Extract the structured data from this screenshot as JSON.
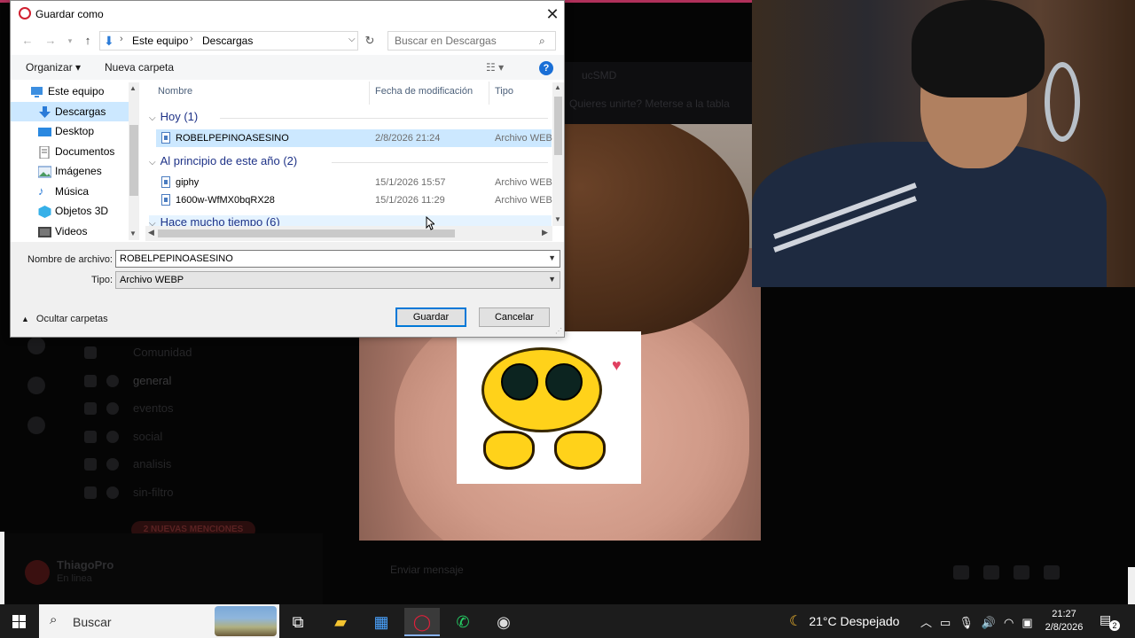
{
  "background_app": {
    "header_line1": "ucSMD",
    "header_line2": "Quieres unirte? Meterse a la tabla",
    "channels": [
      {
        "label": "Comunidad"
      },
      {
        "label": "general"
      },
      {
        "label": "eventos"
      },
      {
        "label": "social"
      },
      {
        "label": "analisis"
      },
      {
        "label": "sin-filtro"
      }
    ],
    "new_mentions": "2 NUEVAS MENCIONES",
    "user_name": "ThiagoPro",
    "user_status": "En linea",
    "chat_placeholder": "Enviar mensaje"
  },
  "dialog": {
    "title": "Guardar como",
    "close_glyph": "✕",
    "address": {
      "crumbs": [
        "Este equipo",
        "Descargas"
      ]
    },
    "search_placeholder": "Buscar en Descargas",
    "commands": {
      "organize": "Organizar ▾",
      "new_folder": "Nueva carpeta",
      "view": "☷ ▾",
      "help": "?"
    },
    "nav_items": [
      {
        "label": "Este equipo",
        "icon": "computer-icon"
      },
      {
        "label": "Descargas",
        "icon": "downloads-icon",
        "selected": true
      },
      {
        "label": "Desktop",
        "icon": "desktop-icon"
      },
      {
        "label": "Documentos",
        "icon": "documents-icon"
      },
      {
        "label": "Imágenes",
        "icon": "pictures-icon"
      },
      {
        "label": "Música",
        "icon": "music-icon"
      },
      {
        "label": "Objetos 3D",
        "icon": "3d-objects-icon"
      },
      {
        "label": "Videos",
        "icon": "videos-icon"
      }
    ],
    "columns": {
      "name": "Nombre",
      "modified": "Fecha de modificación",
      "type": "Tipo"
    },
    "groups": [
      {
        "label": "Hoy (1)"
      },
      {
        "label": "Al principio de este año (2)"
      },
      {
        "label": "Hace mucho tiempo (6)"
      }
    ],
    "files": [
      {
        "name": "ROBELPEPINOASESINO",
        "date": "2/8/2026 21:24",
        "type": "Archivo WEBP",
        "selected": true
      },
      {
        "name": "giphy",
        "date": "15/1/2026 15:57",
        "type": "Archivo WEBP"
      },
      {
        "name": "1600w-WfMX0bqRX28",
        "date": "15/1/2026 11:29",
        "type": "Archivo WEBP"
      }
    ],
    "filename_label": "Nombre de archivo:",
    "filename_value": "ROBELPEPINOASESINO",
    "type_label": "Tipo:",
    "type_value": "Archivo WEBP",
    "hide_folders": "Ocultar carpetas",
    "save_button": "Guardar",
    "cancel_button": "Cancelar"
  },
  "taskbar": {
    "search_text": "Buscar",
    "weather": "21°C  Despejado",
    "time": "21:27",
    "date": "2/8/2026",
    "notifications": "2"
  },
  "colors": {
    "accent": "#0078d7",
    "selection": "#cce8ff",
    "group_text": "#1e3287",
    "taskbar": "#1c1c1c"
  }
}
